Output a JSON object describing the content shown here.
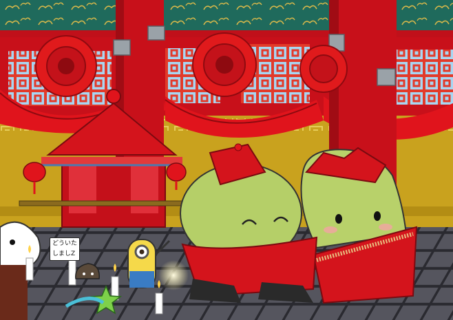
{
  "scene": {
    "sign": {
      "line1": "どういた",
      "line2": "しましZ"
    },
    "characters": [
      "groom-character",
      "bride-character",
      "onigiri-character",
      "minion-character",
      "poop-character",
      "star-character"
    ],
    "colors": {
      "palace_red": "#d4141c",
      "pillar_red": "#c8101a",
      "wall_gold": "#c9a21e",
      "ceiling_teal": "#1f6a5c",
      "sky_blue": "#8fc7ec",
      "character_green": "#b5cf68",
      "floor_gray": "#4a4a52"
    }
  }
}
